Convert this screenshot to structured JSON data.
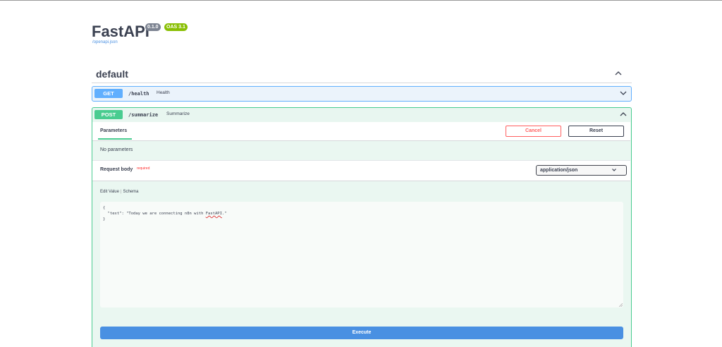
{
  "header": {
    "title": "FastAPI",
    "version_badge": "0.1.0",
    "oas_badge": "OAS 3.1",
    "spec_link": "/openapi.json"
  },
  "tag": {
    "name": "default",
    "toggle_icon": "chevron-up-icon"
  },
  "operations": [
    {
      "method": "GET",
      "path": "/health",
      "summary": "Health",
      "toggle_icon": "chevron-down-icon",
      "color": "#61affe"
    },
    {
      "method": "POST",
      "path": "/summarize",
      "summary": "Summarize",
      "toggle_icon": "chevron-up-icon",
      "color": "#49cc90",
      "parameters_tab": "Parameters",
      "cancel_label": "Cancel",
      "reset_label": "Reset",
      "no_parameters": "No parameters",
      "request_body_label": "Request body",
      "required_label": "required",
      "content_type": "application/json",
      "edit_value_tab": "Edit Value",
      "schema_tab": "Schema",
      "body_line1": "{",
      "body_line2_prefix": "  \"text\": \"Today we are connecting n8n with ",
      "body_line2_word": "FastAPI",
      "body_line2_suffix": ".\"",
      "body_line3": "}",
      "execute_label": "Execute"
    }
  ],
  "colors": {
    "get": "#61affe",
    "post": "#49cc90",
    "execute": "#4990e2",
    "cancel": "#ff6060"
  }
}
